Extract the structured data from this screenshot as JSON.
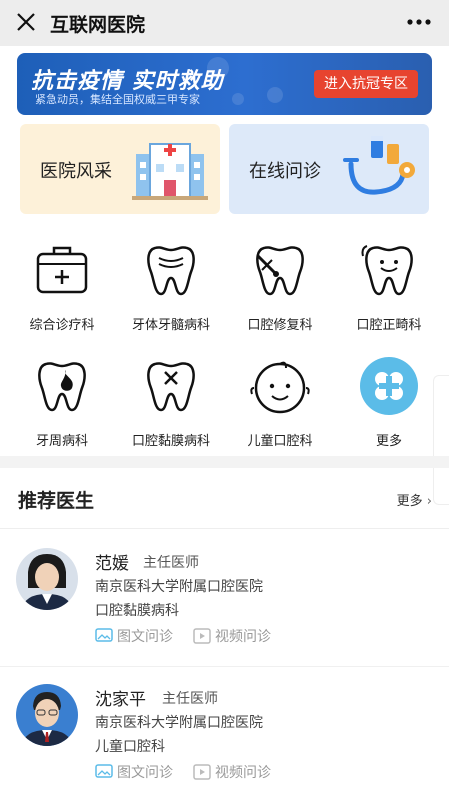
{
  "header": {
    "title": "互联网医院"
  },
  "banner": {
    "headline": "抗击疫情  实时救助",
    "subtitle": "紧急动员，集结全国权威三甲专家",
    "cta": "进入抗冠专区",
    "bg_color": "#2d6ed0",
    "cta_color": "#e7442f"
  },
  "features": [
    {
      "label": "医院风采",
      "icon": "hospital-building-icon",
      "bg": "#fdf1d9"
    },
    {
      "label": "在线问诊",
      "icon": "stethoscope-icon",
      "bg": "#dde9f9"
    }
  ],
  "departments": [
    {
      "label": "综合诊疗科",
      "icon": "medical-kit-icon"
    },
    {
      "label": "牙体牙髓病科",
      "icon": "tooth-icon"
    },
    {
      "label": "口腔修复科",
      "icon": "tooth-repair-icon"
    },
    {
      "label": "口腔正畸科",
      "icon": "smiling-tooth-icon"
    },
    {
      "label": "牙周病科",
      "icon": "tooth-flame-icon"
    },
    {
      "label": "口腔黏膜病科",
      "icon": "tooth-x-icon"
    },
    {
      "label": "儿童口腔科",
      "icon": "baby-face-icon"
    },
    {
      "label": "更多",
      "icon": "clover-more-icon"
    }
  ],
  "recommended": {
    "title": "推荐医生",
    "more": "更多",
    "doctors": [
      {
        "name": "范媛",
        "title": "主任医师",
        "hospital": "南京医科大学附属口腔医院",
        "department": "口腔黏膜病科",
        "services": [
          "图文问诊",
          "视频问诊"
        ]
      },
      {
        "name": "沈家平",
        "title": "主任医师",
        "hospital": "南京医科大学附属口腔医院",
        "department": "儿童口腔科",
        "services": [
          "图文问诊",
          "视频问诊"
        ]
      }
    ]
  }
}
